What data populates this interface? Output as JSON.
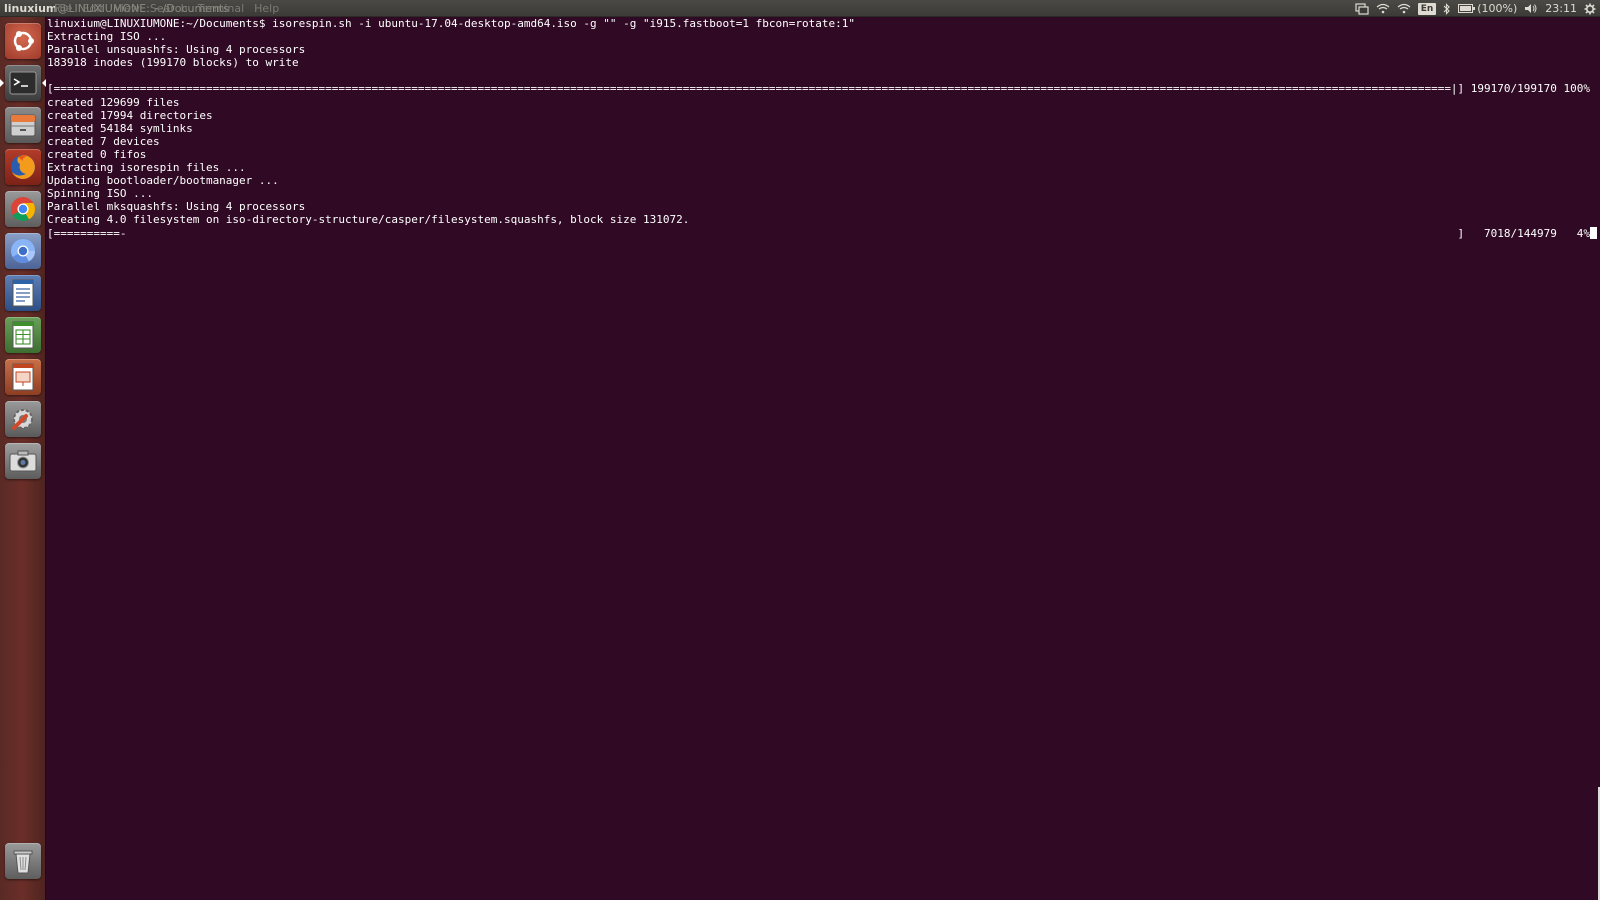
{
  "top_panel": {
    "window_title_user": "linuxium",
    "window_title_rest": "@LINUXIUMONE: ~/Documents",
    "menu_items": [
      "File",
      "Edit",
      "View",
      "Search",
      "Terminal",
      "Help"
    ],
    "keyboard_layout": "En",
    "battery_text": "(100%)",
    "clock": "23:11"
  },
  "launcher": {
    "items": [
      "dash-home",
      "terminal",
      "files",
      "firefox",
      "chrome",
      "chromium",
      "writer",
      "calc",
      "impress",
      "system-settings",
      "screenshot",
      "trash"
    ]
  },
  "terminal": {
    "lines": [
      "linuxium@LINUXIUMONE:~/Documents$ isorespin.sh -i ubuntu-17.04-desktop-amd64.iso -g \"\" -g \"i915.fastboot=1 fbcon=rotate:1\"",
      "Extracting ISO ...",
      "Parallel unsquashfs: Using 4 processors",
      "183918 inodes (199170 blocks) to write",
      ""
    ],
    "progress1_open": "[",
    "progress1_bar": "==========================================================================================================================================================================================================================================================================================================",
    "progress1_tail": "|] 199170/199170 100%",
    "lines2": [
      "created 129699 files",
      "created 17994 directories",
      "created 54184 symlinks",
      "created 7 devices",
      "created 0 fifos",
      "Extracting isorespin files ...",
      "Updating bootloader/bootmanager ...",
      "Spinning ISO ...",
      "Parallel mksquashfs: Using 4 processors",
      "Creating 4.0 filesystem on iso-directory-structure/casper/filesystem.squashfs, block size 131072."
    ],
    "progress2_fill": "[==========-",
    "progress2_tail": "]   7018/144979   4%"
  }
}
